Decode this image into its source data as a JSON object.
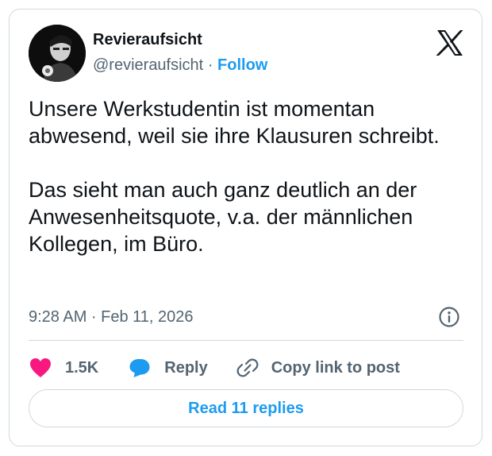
{
  "author": {
    "name": "Revieraufsicht",
    "handle": "@revieraufsicht",
    "separator": "·",
    "follow_label": "Follow"
  },
  "tweet": {
    "paragraphs": [
      "Unsere Werkstudentin ist momentan abwesend, weil sie ihre Klausuren schreibt.",
      "Das sieht man auch ganz deutlich an der Anwesenheitsquote, v.a. der männlichen Kollegen, im Büro."
    ],
    "timestamp": "9:28 AM · Feb 11, 2026"
  },
  "actions": {
    "likes": "1.5K",
    "reply_label": "Reply",
    "copy_label": "Copy link to post"
  },
  "read_replies_label": "Read 11 replies",
  "icons": {
    "brand": "x-logo-icon",
    "info": "info-icon",
    "like": "heart-icon",
    "reply": "reply-bubble-icon",
    "copy": "link-icon"
  },
  "colors": {
    "accent": "#1d9bf0",
    "like": "#f91880",
    "text": "#0f1419",
    "muted": "#536471",
    "border": "#cfd9de"
  }
}
